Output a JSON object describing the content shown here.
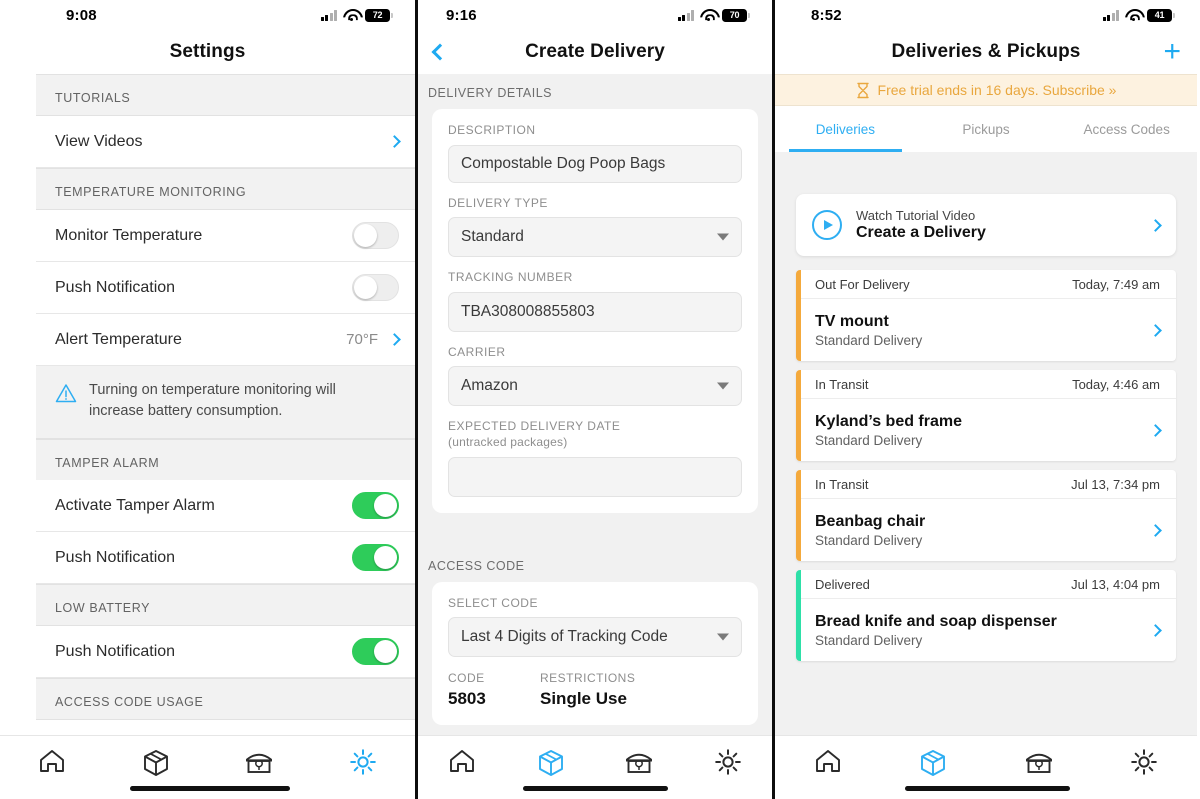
{
  "panels": {
    "settings": {
      "status": {
        "time": "9:08",
        "battery": "72"
      },
      "title": "Settings",
      "sections": [
        {
          "header": "TUTORIALS",
          "rows": [
            {
              "label": "View Videos",
              "type": "link"
            }
          ]
        },
        {
          "header": "TEMPERATURE MONITORING",
          "rows": [
            {
              "label": "Monitor Temperature",
              "type": "toggle",
              "on": false
            },
            {
              "label": "Push Notification",
              "type": "toggle",
              "on": false
            },
            {
              "label": "Alert Temperature",
              "type": "value",
              "value": "70°F"
            }
          ],
          "note": "Turning on temperature monitoring will increase battery consumption."
        },
        {
          "header": "TAMPER ALARM",
          "rows": [
            {
              "label": "Activate Tamper Alarm",
              "type": "toggle",
              "on": true
            },
            {
              "label": "Push Notification",
              "type": "toggle",
              "on": true
            }
          ]
        },
        {
          "header": "LOW BATTERY",
          "rows": [
            {
              "label": "Push Notification",
              "type": "toggle",
              "on": true
            }
          ]
        },
        {
          "header": "ACCESS CODE USAGE",
          "rows": []
        }
      ],
      "tabbar": {
        "active": "settings",
        "items": [
          "home-icon",
          "package-icon",
          "mailbox-icon",
          "gear-icon"
        ]
      }
    },
    "create_delivery": {
      "status": {
        "time": "9:16",
        "battery": "70"
      },
      "title": "Create Delivery",
      "back_icon": "chevron-left-icon",
      "section1_header": "DELIVERY DETAILS",
      "fields": [
        {
          "label": "DESCRIPTION",
          "value": "Compostable Dog Poop Bags",
          "kind": "text"
        },
        {
          "label": "DELIVERY TYPE",
          "value": "Standard",
          "kind": "select"
        },
        {
          "label": "TRACKING NUMBER",
          "value": "TBA308008855803",
          "kind": "text"
        },
        {
          "label": "CARRIER",
          "value": "Amazon",
          "kind": "select"
        },
        {
          "label": "EXPECTED DELIVERY DATE",
          "sublabel": "(untracked packages)",
          "value": "",
          "kind": "text"
        }
      ],
      "section2_header": "ACCESS CODE",
      "select_code_label": "SELECT CODE",
      "select_code_value": "Last 4 Digits of Tracking Code",
      "code_table": {
        "columns": [
          "CODE",
          "RESTRICTIONS"
        ],
        "rows": [
          [
            "5803",
            "Single Use"
          ]
        ]
      },
      "tabbar": {
        "active": "package",
        "items": [
          "home-icon",
          "package-icon",
          "mailbox-icon",
          "gear-icon"
        ]
      }
    },
    "deliveries": {
      "status": {
        "time": "8:52",
        "battery": "41"
      },
      "title": "Deliveries & Pickups",
      "add_icon": "plus-icon",
      "trial_banner": {
        "icon": "hourglass-icon",
        "text": "Free trial ends in 16 days. Subscribe »"
      },
      "tabs": [
        {
          "label": "Deliveries",
          "active": true
        },
        {
          "label": "Pickups",
          "active": false
        },
        {
          "label": "Access Codes",
          "active": false
        }
      ],
      "tutorial_card": {
        "eyebrow": "Watch Tutorial Video",
        "title": "Create a Delivery",
        "icon": "play-circle-icon"
      },
      "items": [
        {
          "status": "Out For Delivery",
          "time": "Today, 7:49 am",
          "title": "TV mount",
          "subtitle": "Standard Delivery",
          "color": "#f4a93c"
        },
        {
          "status": "In Transit",
          "time": "Today, 4:46 am",
          "title": "Kyland’s bed frame",
          "subtitle": "Standard Delivery",
          "color": "#f4a93c"
        },
        {
          "status": "In Transit",
          "time": "Jul 13, 7:34 pm",
          "title": "Beanbag chair",
          "subtitle": "Standard Delivery",
          "color": "#f4a93c"
        },
        {
          "status": "Delivered",
          "time": "Jul 13, 4:04 pm",
          "title": "Bread knife and soap dispenser",
          "subtitle": "Standard Delivery",
          "color": "#2ee0a8"
        }
      ],
      "tabbar": {
        "active": "package",
        "items": [
          "home-icon",
          "package-icon",
          "mailbox-icon",
          "gear-icon"
        ]
      }
    }
  },
  "colors": {
    "accent": "#1eaaf1",
    "toggle_on": "#2ecc5a",
    "trial": "#e9a73e",
    "status_transit": "#f4a93c",
    "status_delivered": "#2ee0a8"
  }
}
